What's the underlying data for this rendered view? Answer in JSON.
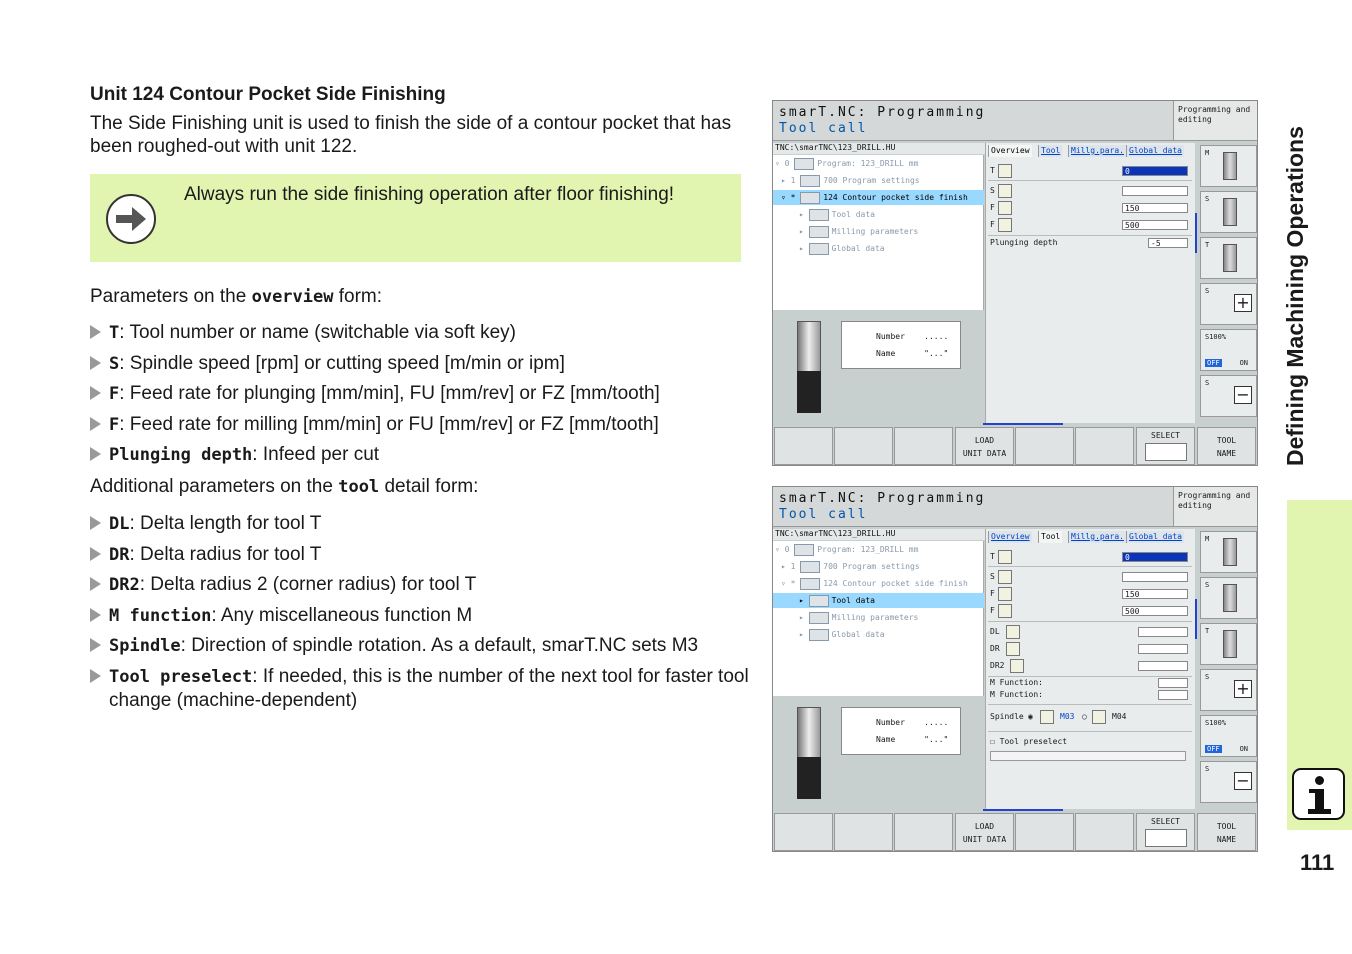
{
  "heading": "Unit 124 Contour Pocket Side Finishing",
  "intro": "The Side Finishing unit is used to finish the side of a contour pocket that has been roughed-out with unit 122.",
  "note": "Always run the side finishing operation after floor finishing!",
  "overview_intro": {
    "pre": "Parameters on the ",
    "kw": "overview",
    "post": " form:"
  },
  "overview_params": [
    {
      "kw": "T",
      "text": ": Tool number or name (switchable via soft key)"
    },
    {
      "kw": "S",
      "text": ": Spindle speed [rpm] or cutting speed [m/min or ipm]"
    },
    {
      "kw": "F",
      "text": ": Feed rate for plunging [mm/min], FU [mm/rev] or FZ [mm/tooth]"
    },
    {
      "kw": "F",
      "text": ": Feed rate for milling [mm/min] or FU [mm/rev] or FZ [mm/tooth]"
    },
    {
      "kw": "Plunging depth",
      "text": ": Infeed per cut"
    }
  ],
  "tool_intro": {
    "pre": "Additional parameters on the ",
    "kw": "tool",
    "post": " detail form:"
  },
  "tool_params": [
    {
      "kw": "DL",
      "text": ": Delta length for tool T"
    },
    {
      "kw": "DR",
      "text": ": Delta radius for tool T"
    },
    {
      "kw": "DR2",
      "text": ": Delta radius 2 (corner radius) for tool T"
    },
    {
      "kw": "M function",
      "text": ": Any miscellaneous function M"
    },
    {
      "kw": "Spindle",
      "text": ": Direction of spindle rotation. As a default, smarT.NC sets M3"
    },
    {
      "kw": "Tool preselect",
      "text": ": If needed, this is the number of the next tool for faster tool change (machine-dependent)"
    }
  ],
  "sidebar": {
    "title": "Defining Machining Operations",
    "page_number": "111"
  },
  "screen": {
    "title": "smarT.NC: Programming",
    "subtitle": "Tool call",
    "mode": "Programming and editing",
    "path": "TNC:\\smarTNC\\123_DRILL.HU",
    "tree": [
      "Program: 123_DRILL mm",
      "700 Program settings",
      "124 Contour pocket side finish",
      "Tool data",
      "Milling parameters",
      "Global data"
    ],
    "tabs": [
      "Overview",
      "Tool",
      "Millg.para.",
      "Global data"
    ],
    "info_number_label": "Number",
    "info_number_value": ".....",
    "info_name_label": "Name",
    "info_name_value": "\"...\"",
    "softkeys": {
      "load": "LOAD",
      "unit_data": "UNIT DATA",
      "select": "SELECT",
      "tool": "TOOL",
      "name": "NAME"
    },
    "vkeys": {
      "m": "M",
      "s": "S",
      "t": "T",
      "s100": "S100%",
      "off": "OFF",
      "on": "ON"
    },
    "fields": {
      "t_label": "T",
      "s_label": "S",
      "f_label": "F",
      "t_value": "0",
      "f1_value": "150",
      "f2_value": "500"
    },
    "screen1": {
      "plunging_label": "Plunging depth",
      "plunging_value": "-5"
    },
    "screen2": {
      "dl": "DL",
      "dr": "DR",
      "dr2": "DR2",
      "m_function": "M Function:",
      "spindle": "Spindle",
      "m03": "M03",
      "m04": "M04",
      "tool_preselect": "Tool preselect"
    }
  }
}
